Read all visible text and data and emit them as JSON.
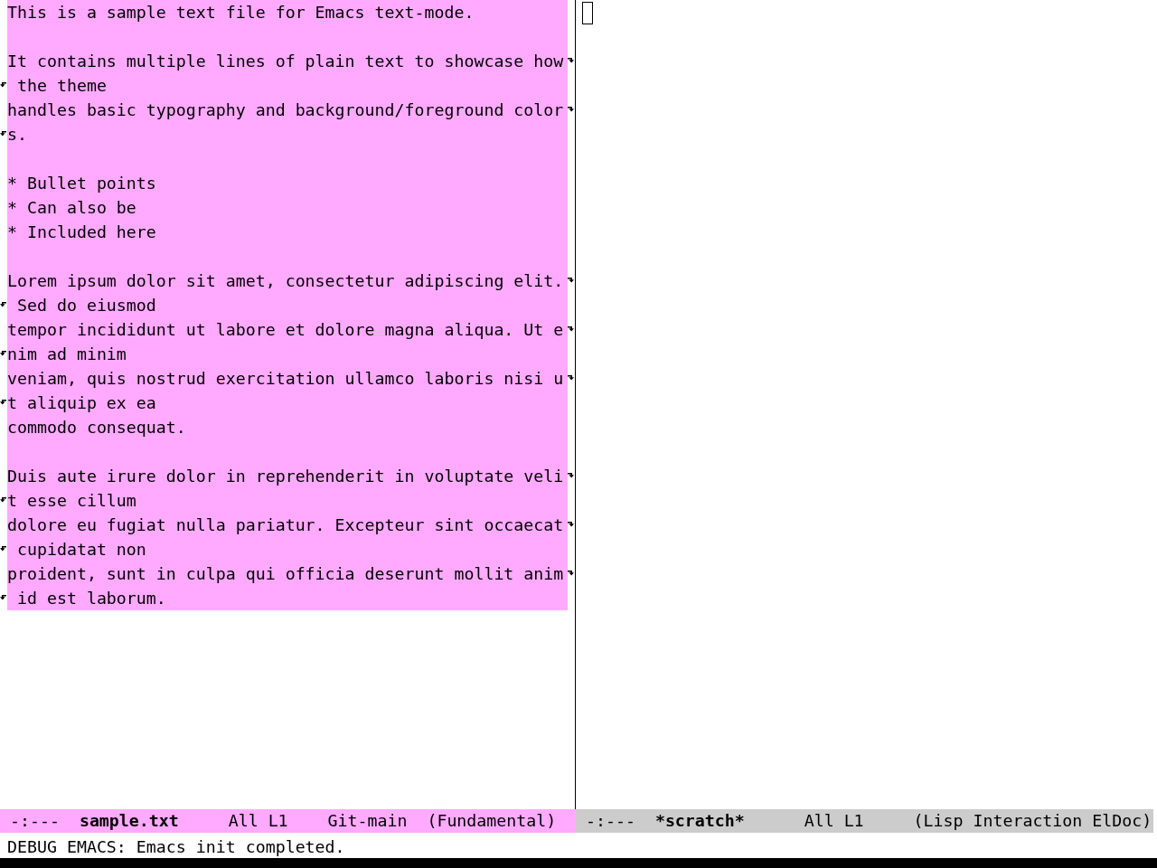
{
  "windows": [
    {
      "active": true,
      "paragraphs": [
        {
          "rows": [
            {
              "text": "This is a sample text file for Emacs text-mode.",
              "continued": false
            }
          ]
        },
        {
          "rows": [
            {
              "text": "It contains multiple lines of plain text to showcase how",
              "continued": true
            },
            {
              "text": " the theme",
              "continued": false
            },
            {
              "text": "handles basic typography and background/foreground color",
              "continued": true
            },
            {
              "text": "s.",
              "continued": false
            }
          ]
        },
        {
          "rows": [
            {
              "text": "* Bullet points",
              "continued": false
            },
            {
              "text": "* Can also be",
              "continued": false
            },
            {
              "text": "* Included here",
              "continued": false
            }
          ]
        },
        {
          "rows": [
            {
              "text": "Lorem ipsum dolor sit amet, consectetur adipiscing elit.",
              "continued": true
            },
            {
              "text": " Sed do eiusmod",
              "continued": false
            },
            {
              "text": "tempor incididunt ut labore et dolore magna aliqua. Ut e",
              "continued": true
            },
            {
              "text": "nim ad minim",
              "continued": false
            },
            {
              "text": "veniam, quis nostrud exercitation ullamco laboris nisi u",
              "continued": true
            },
            {
              "text": "t aliquip ex ea",
              "continued": false
            },
            {
              "text": "commodo consequat.",
              "continued": false
            }
          ]
        },
        {
          "rows": [
            {
              "text": "Duis aute irure dolor in reprehenderit in voluptate veli",
              "continued": true
            },
            {
              "text": "t esse cillum",
              "continued": false
            },
            {
              "text": "dolore eu fugiat nulla pariatur. Excepteur sint occaecat",
              "continued": true
            },
            {
              "text": " cupidatat non",
              "continued": false
            },
            {
              "text": "proident, sunt in culpa qui officia deserunt mollit anim",
              "continued": true
            },
            {
              "text": " id est laborum.",
              "continued": false
            }
          ]
        }
      ],
      "mode_line": {
        "status": "-:---",
        "buffer_name": "sample.txt",
        "position": "All L1",
        "vc_branch": "Git-main",
        "major_mode": "(Fundamental)"
      }
    },
    {
      "active": false,
      "cursor": true,
      "mode_line": {
        "status": "-:---",
        "buffer_name": "*scratch*",
        "position": "All L1",
        "major_mode": "(Lisp Interaction ElDoc)"
      }
    }
  ],
  "echo_area": "DEBUG EMACS: Emacs init completed."
}
